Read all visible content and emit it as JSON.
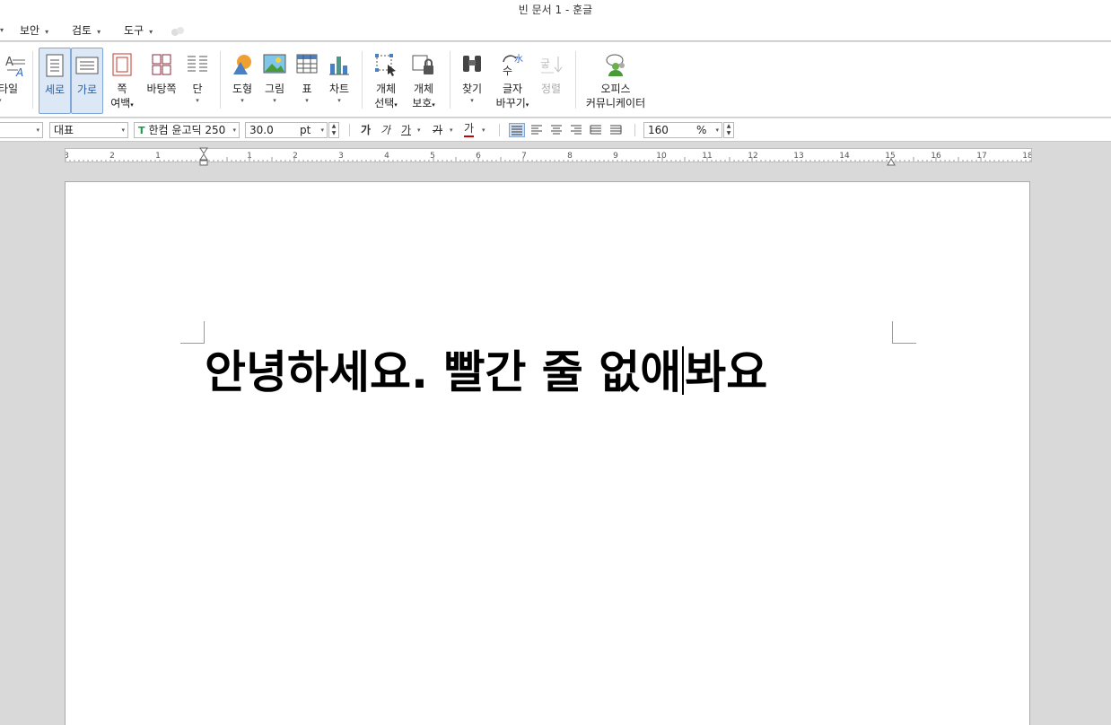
{
  "title": "빈 문서 1 - 훈글",
  "menu": [
    {
      "label": "보안"
    },
    {
      "label": "검토"
    },
    {
      "label": "도구"
    }
  ],
  "ribbon": {
    "style": "타일",
    "portrait": "세로",
    "landscape": "가로",
    "margin_top": "쪽",
    "margin_bottom": "여백",
    "background_page": "바탕쪽",
    "columns": "단",
    "shape": "도형",
    "picture": "그림",
    "table": "표",
    "chart": "차트",
    "select_top": "개체",
    "select_bottom": "선택",
    "protect_top": "개체",
    "protect_bottom": "보호",
    "find": "찾기",
    "replace_top": "글자",
    "replace_bottom": "바꾸기",
    "sort": "정렬",
    "office_top": "오피스",
    "office_bottom": "커뮤니케이터",
    "replace_icon_chars": "수",
    "replace_icon_chars2": "水",
    "sort_icon_chars": "긓"
  },
  "format": {
    "style_value": "대표",
    "font_value": "한컴 윤고딕 250",
    "size_value": "30.0",
    "size_unit": "pt",
    "zoom_value": "160",
    "zoom_unit": "%",
    "bold": "가",
    "italic": "가",
    "underline": "가",
    "strike": "가",
    "color": "가"
  },
  "ruler": {
    "labels": [
      "3",
      "2",
      "1",
      "1",
      "2",
      "3",
      "4",
      "5",
      "6",
      "7",
      "8",
      "9",
      "10",
      "11",
      "12",
      "13",
      "14",
      "15",
      "16",
      "17",
      "18"
    ]
  },
  "document": {
    "before_cursor": "안녕하세요. 빨간 줄 없애",
    "after_cursor": "봐요"
  },
  "colors": {
    "accent": "#4a7fc1",
    "active_bg": "#dce8f6",
    "page_bg": "#d9d9d9"
  }
}
